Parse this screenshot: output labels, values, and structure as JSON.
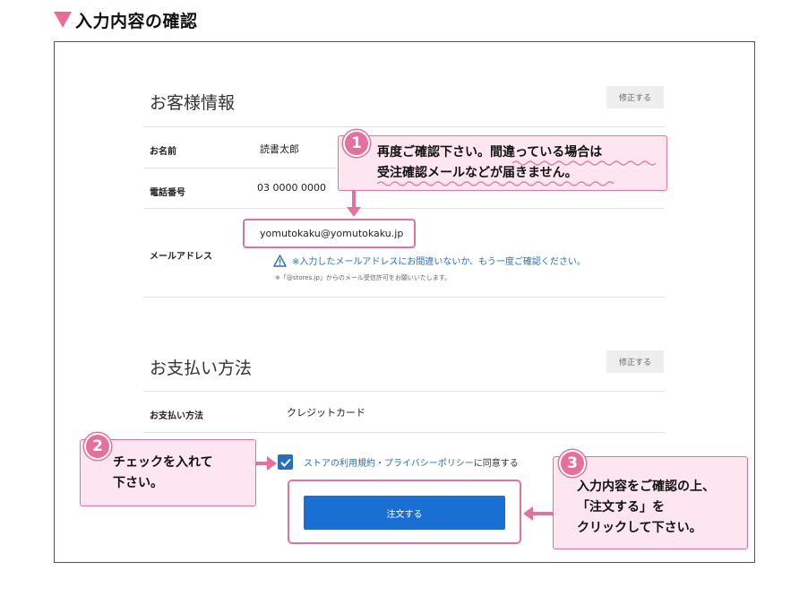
{
  "page_heading": "入力内容の確認",
  "customer": {
    "title": "お客様情報",
    "edit_label": "修正する",
    "name_label": "お名前",
    "name_value": "読書太郎",
    "phone_label": "電話番号",
    "phone_value": "03 0000 0000",
    "email_label": "メールアドレス",
    "email_value": "yomutokaku@yomutokaku.jp",
    "email_warning": "※入力したメールアドレスにお間違いないか、もう一度ご確認ください。",
    "email_note": "※「@stores.jp」からのメール受信許可をお願いいたします。"
  },
  "payment": {
    "title": "お支払い方法",
    "edit_label": "修正する",
    "method_label": "お支払い方法",
    "method_value": "クレジットカード"
  },
  "terms": {
    "link_text": "ストアの利用規約・プライバシーポリシー",
    "tail_text": "に同意する",
    "checked": true
  },
  "order_button_label": "注文する",
  "callouts": {
    "c1": {
      "number": "1",
      "line1": "再度ご確認下さい。間違っている場合は",
      "line2": "受注確認メールなどが届きません。"
    },
    "c2": {
      "number": "2",
      "line1": "チェックを入れて",
      "line2": "下さい。"
    },
    "c3": {
      "number": "3",
      "line1": "入力内容をご確認の上、",
      "line2": "「注文する」を",
      "line3": "クリックして下さい。"
    }
  },
  "colors": {
    "accent_pink": "#e5709e",
    "callout_bg": "#fde6ef",
    "button_blue": "#1a6fd3",
    "link_blue": "#2a6fb5"
  },
  "icons": [
    "warning-icon",
    "checkmark-icon"
  ]
}
